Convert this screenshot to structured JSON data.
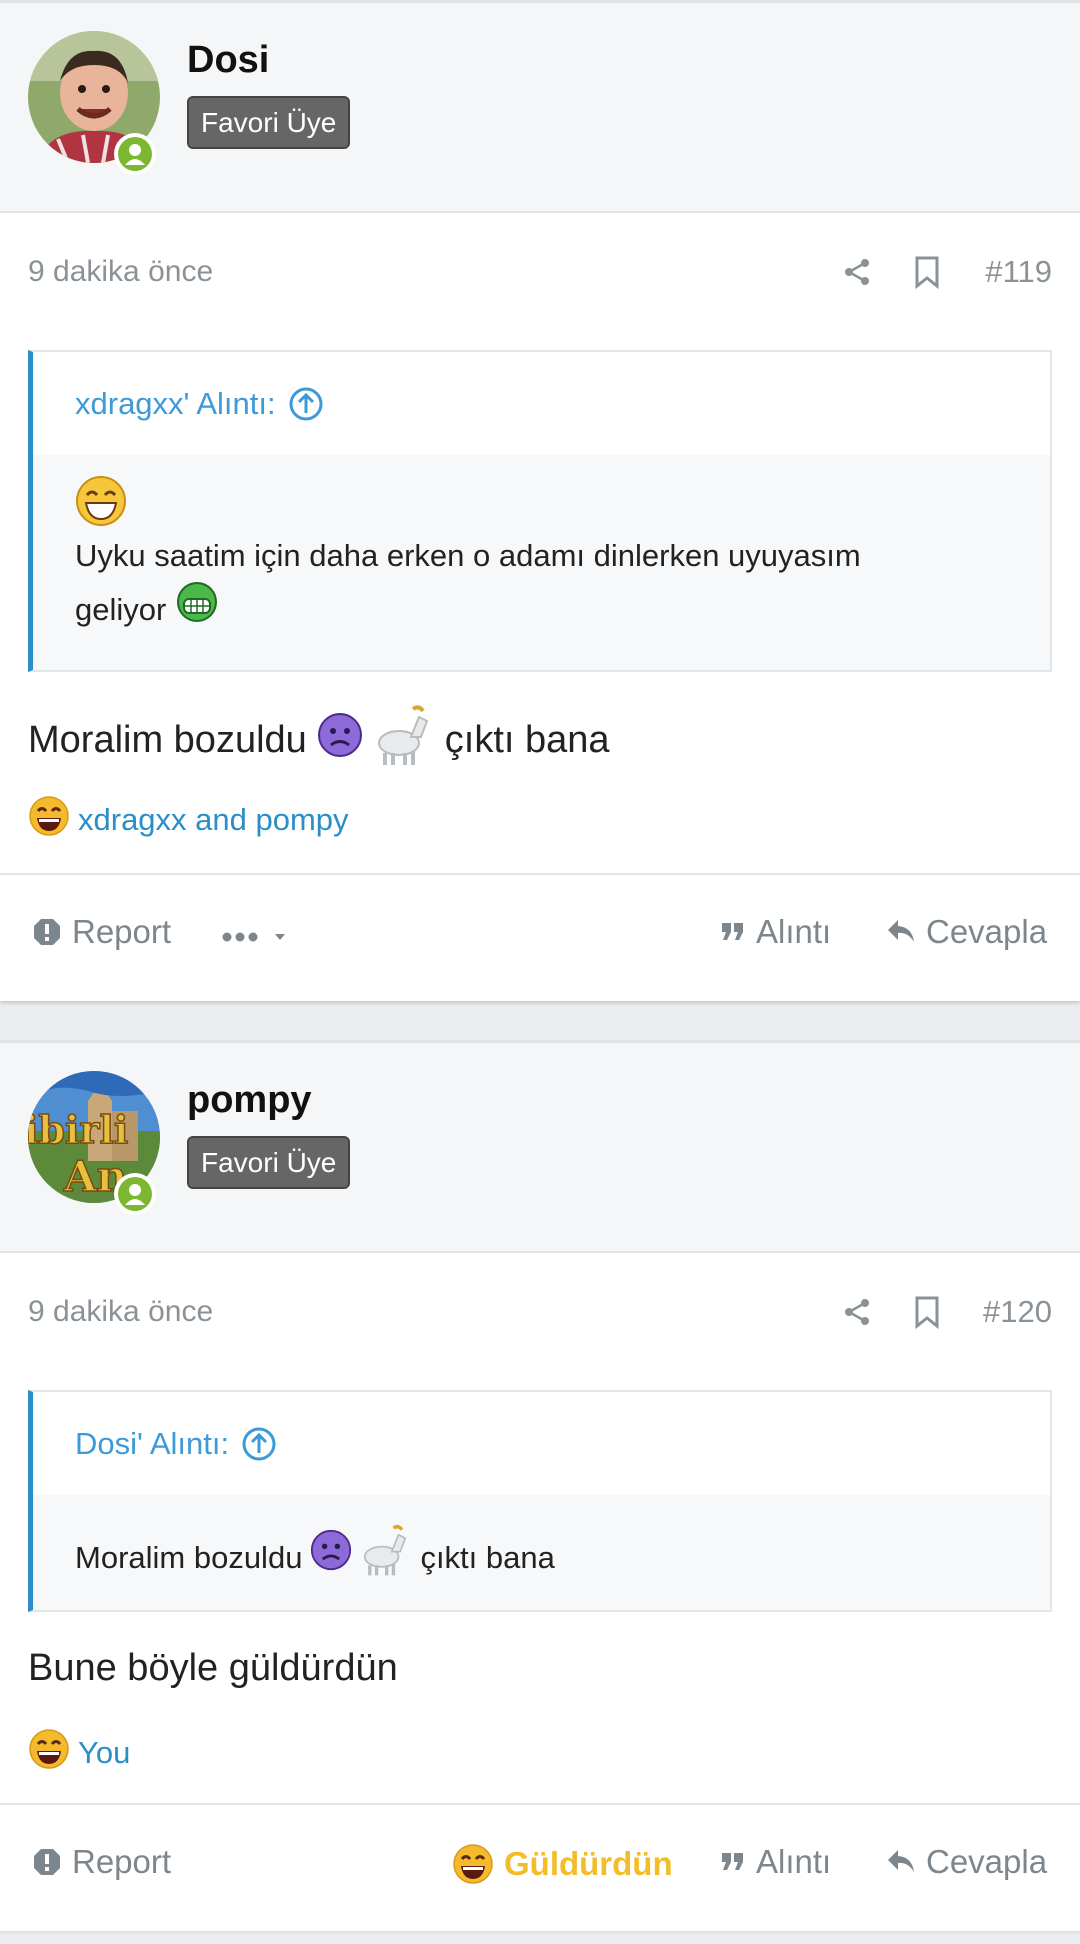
{
  "posts": [
    {
      "username": "Dosi",
      "badge": "Favori Üye",
      "time": "9 dakika önce",
      "post_number": "#119",
      "quote": {
        "title": "xdragxx' Alıntı:",
        "line1": "Uyku saatim için daha erken o adamı dinlerken uyuyasım",
        "line2": "geliyor"
      },
      "message_part1": "Moralim bozuldu",
      "message_part2": "çıktı bana",
      "reactions": "xdragxx and pompy",
      "footer": {
        "report": "Report",
        "quote": "Alıntı",
        "reply": "Cevapla"
      }
    },
    {
      "username": "pompy",
      "badge": "Favori Üye",
      "time": "9 dakika önce",
      "post_number": "#120",
      "quote": {
        "title": "Dosi' Alıntı:",
        "line1_part1": "Moralim bozuldu",
        "line1_part2": "çıktı bana"
      },
      "message": "Bune böyle güldürdün",
      "reactions": "You",
      "footer": {
        "report": "Report",
        "reacted": "Güldürdün",
        "quote": "Alıntı",
        "reply": "Cevapla"
      }
    }
  ],
  "colors": {
    "link": "#2a8ec8",
    "online": "#7cb82f",
    "reacted": "#f3bd2a",
    "badge": "#666666"
  }
}
